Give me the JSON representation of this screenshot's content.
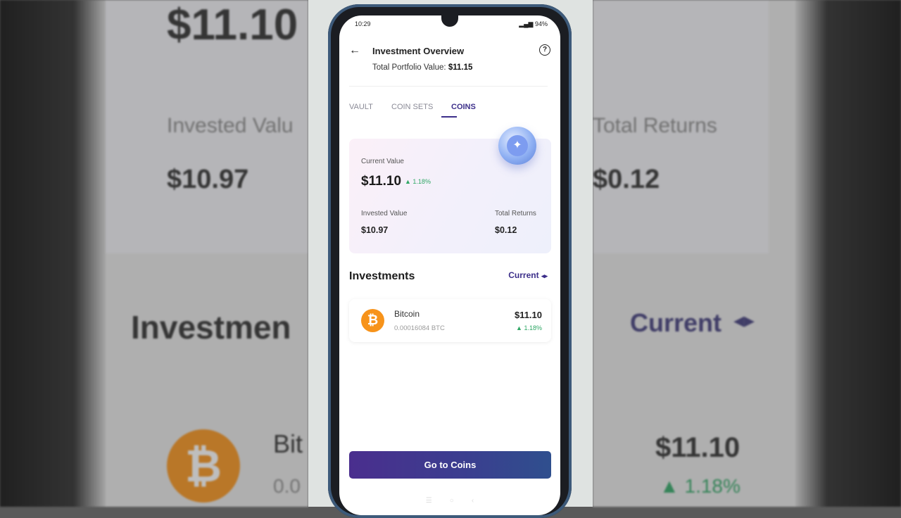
{
  "status": {
    "time": "10:29",
    "battery": "94%"
  },
  "header": {
    "title": "Investment Overview",
    "portfolio_label": "Total Portfolio Value:",
    "portfolio_value": "$11.15"
  },
  "tabs": [
    {
      "label": "VAULT"
    },
    {
      "label": "COIN SETS"
    },
    {
      "label": "COINS",
      "active": true
    }
  ],
  "value_card": {
    "current_label": "Current Value",
    "current_value": "$11.10",
    "current_change": "1.18%",
    "invested_label": "Invested Value",
    "invested_value": "$10.97",
    "returns_label": "Total Returns",
    "returns_value": "$0.12"
  },
  "investments": {
    "title": "Investments",
    "sort_label": "Current",
    "items": [
      {
        "name": "Bitcoin",
        "quantity": "0.00016084 BTC",
        "value": "$11.10",
        "change": "1.18%",
        "icon": "bitcoin-icon"
      }
    ]
  },
  "cta": {
    "label": "Go to Coins"
  },
  "background_zoom": {
    "left_value": "$11.10",
    "left_invested_label": "Invested Valu",
    "left_invested_value": "$10.97",
    "left_section": "Investmen",
    "left_name": "Bit",
    "left_qty": "0.0",
    "right_returns_label": "Total Returns",
    "right_returns_value": "$0.12",
    "right_sort": "Current",
    "right_value": "$11.10",
    "right_change": "1.18%"
  },
  "colors": {
    "accent": "#3c2f8a",
    "positive": "#2fa765",
    "bitcoin": "#f7931a"
  }
}
